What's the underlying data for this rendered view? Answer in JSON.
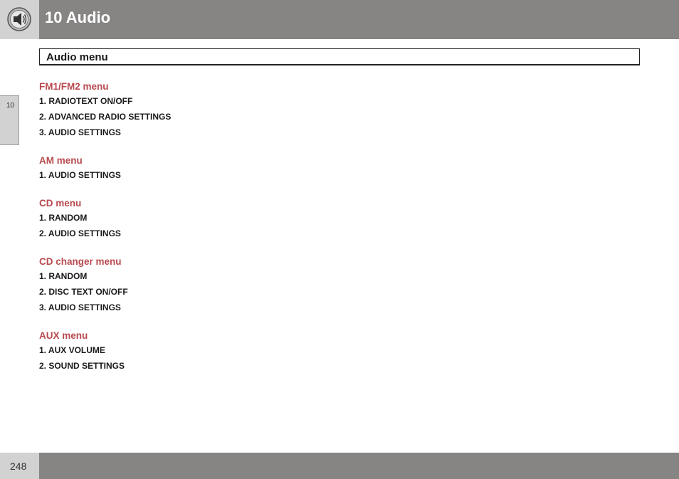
{
  "header": {
    "title": "10 Audio",
    "icon": "speaker-icon"
  },
  "side_tab": {
    "label": "10"
  },
  "section": {
    "title": "Audio menu"
  },
  "menus": [
    {
      "heading": "FM1/FM2 menu",
      "items": [
        "1. RADIOTEXT ON/OFF",
        "2. ADVANCED RADIO SETTINGS",
        "3. AUDIO SETTINGS"
      ]
    },
    {
      "heading": "AM menu",
      "items": [
        "1. AUDIO SETTINGS"
      ]
    },
    {
      "heading": "CD menu",
      "items": [
        "1. RANDOM",
        "2. AUDIO SETTINGS"
      ]
    },
    {
      "heading": "CD changer menu",
      "items": [
        "1. RANDOM",
        "2. DISC TEXT ON/OFF",
        "3. AUDIO SETTINGS"
      ]
    },
    {
      "heading": "AUX menu",
      "items": [
        "1. AUX VOLUME",
        "2. SOUND SETTINGS"
      ]
    }
  ],
  "footer": {
    "page_number": "248"
  },
  "colors": {
    "header_bar": "#878584",
    "icon_box": "#d2d2d2",
    "heading_accent": "#b84a4f"
  }
}
